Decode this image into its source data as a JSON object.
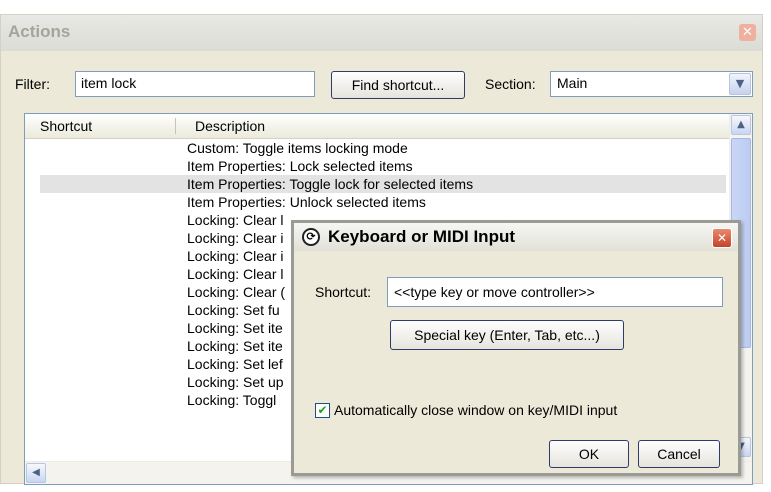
{
  "actions": {
    "title": "Actions",
    "filter_label": "Filter:",
    "filter_value": "item lock",
    "find_shortcut_label": "Find shortcut...",
    "section_label": "Section:",
    "section_value": "Main",
    "columns": {
      "shortcut": "Shortcut",
      "description": "Description"
    },
    "rows": [
      {
        "shortcut": "",
        "description": "Custom: Toggle items locking mode",
        "selected": false
      },
      {
        "shortcut": "",
        "description": "Item Properties: Lock selected items",
        "selected": false
      },
      {
        "shortcut": "",
        "description": "Item Properties: Toggle lock for selected items",
        "selected": true
      },
      {
        "shortcut": "",
        "description": "Item Properties: Unlock selected items",
        "selected": false
      },
      {
        "shortcut": "",
        "description": "Locking: Clear l",
        "selected": false
      },
      {
        "shortcut": "",
        "description": "Locking: Clear i",
        "selected": false
      },
      {
        "shortcut": "",
        "description": "Locking: Clear i",
        "selected": false
      },
      {
        "shortcut": "",
        "description": "Locking: Clear l",
        "selected": false
      },
      {
        "shortcut": "",
        "description": "Locking: Clear (",
        "selected": false
      },
      {
        "shortcut": "",
        "description": "Locking: Set fu",
        "selected": false
      },
      {
        "shortcut": "",
        "description": "Locking: Set ite",
        "selected": false
      },
      {
        "shortcut": "",
        "description": "Locking: Set ite",
        "selected": false
      },
      {
        "shortcut": "",
        "description": "Locking: Set lef",
        "selected": false
      },
      {
        "shortcut": "",
        "description": "Locking: Set up",
        "selected": false
      },
      {
        "shortcut": "",
        "description": "Locking: Toggl",
        "selected": false
      }
    ]
  },
  "dialog": {
    "title": "Keyboard or MIDI Input",
    "shortcut_label": "Shortcut:",
    "shortcut_value": "<<type key or move controller>>",
    "special_key_label": "Special key (Enter, Tab, etc...)",
    "auto_close_label": "Automatically close window on key/MIDI input",
    "auto_close_checked": true,
    "ok_label": "OK",
    "cancel_label": "Cancel"
  },
  "icons": {
    "close": "close-icon",
    "dropdown": "chevron-down-icon",
    "scroll_up": "scroll-up-arrow-icon",
    "scroll_down": "scroll-down-arrow-icon",
    "scroll_left": "scroll-left-arrow-icon",
    "dialog_logo": "reaper-logo-icon",
    "checkmark": "checkmark-icon"
  }
}
